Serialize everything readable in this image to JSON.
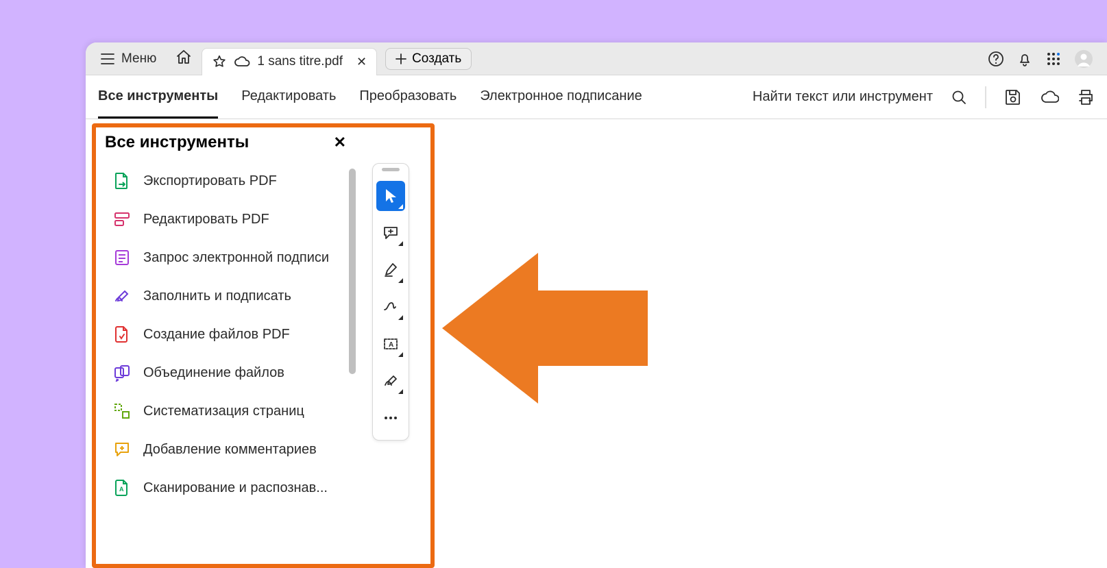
{
  "titlebar": {
    "menu_label": "Меню",
    "tab_title": "1 sans titre.pdf",
    "create_label": "Создать"
  },
  "toolbar": {
    "nav": [
      "Все инструменты",
      "Редактировать",
      "Преобразовать",
      "Электронное подписание"
    ],
    "search_placeholder": "Найти текст или инструмент"
  },
  "tools_panel": {
    "title": "Все инструменты",
    "items": [
      "Экспортировать PDF",
      "Редактировать PDF",
      "Запрос электронной подписи",
      "Заполнить и подписать",
      "Создание файлов PDF",
      "Объединение файлов",
      "Систематизация страниц",
      "Добавление комментариев",
      "Сканирование и распознав..."
    ]
  }
}
